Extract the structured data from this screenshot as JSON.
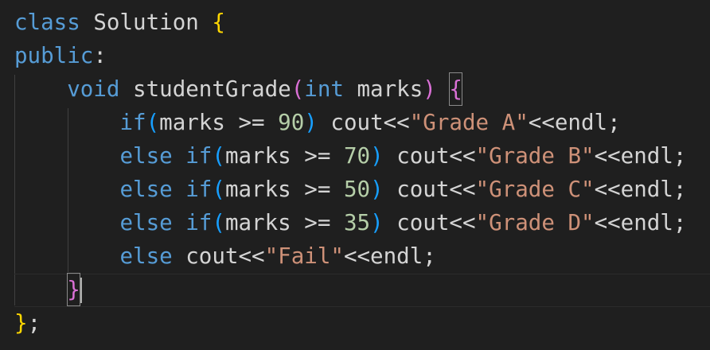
{
  "editor": {
    "lines": {
      "line1": {
        "kw": "class",
        "name": " Solution ",
        "brace": "{"
      },
      "line2": {
        "kw": "public",
        "colon": ":"
      },
      "line3": {
        "indent": "    ",
        "ret": "void",
        "fn": " studentGrade",
        "lp": "(",
        "type": "int",
        "param": " marks",
        "rp": ")",
        "sp": " ",
        "brace": "{"
      },
      "line4": {
        "indent": "        ",
        "ifkw": "if",
        "lp": "(",
        "cond": "marks >= ",
        "num": "90",
        "rp": ")",
        "cout": " cout<<",
        "str": "\"Grade A\"",
        "end": "<<endl;"
      },
      "line5": {
        "indent": "        ",
        "elsekw": "else",
        "sp": " ",
        "ifkw": "if",
        "lp": "(",
        "cond": "marks >= ",
        "num": "70",
        "rp": ")",
        "cout": " cout<<",
        "str": "\"Grade B\"",
        "end": "<<endl;"
      },
      "line6": {
        "indent": "        ",
        "elsekw": "else",
        "sp": " ",
        "ifkw": "if",
        "lp": "(",
        "cond": "marks >= ",
        "num": "50",
        "rp": ")",
        "cout": " cout<<",
        "str": "\"Grade C\"",
        "end": "<<endl;"
      },
      "line7": {
        "indent": "        ",
        "elsekw": "else",
        "sp": " ",
        "ifkw": "if",
        "lp": "(",
        "cond": "marks >= ",
        "num": "35",
        "rp": ")",
        "cout": " cout<<",
        "str": "\"Grade D\"",
        "end": "<<endl;"
      },
      "line8": {
        "indent": "        ",
        "elsekw": "else",
        "cout": " cout<<",
        "str": "\"Fail\"",
        "end": "<<endl;"
      },
      "line9": {
        "indent": "    ",
        "brace": "}"
      },
      "line10": {
        "brace": "}",
        "semi": ";"
      }
    }
  },
  "colors": {
    "background": "#1f1f1f",
    "keyword": "#569cd6",
    "number": "#b5cea8",
    "string": "#ce9178",
    "brace_level1": "#ffd700",
    "brace_level2": "#da70d6",
    "paren": "#179fff",
    "text": "#d4d4d4"
  }
}
